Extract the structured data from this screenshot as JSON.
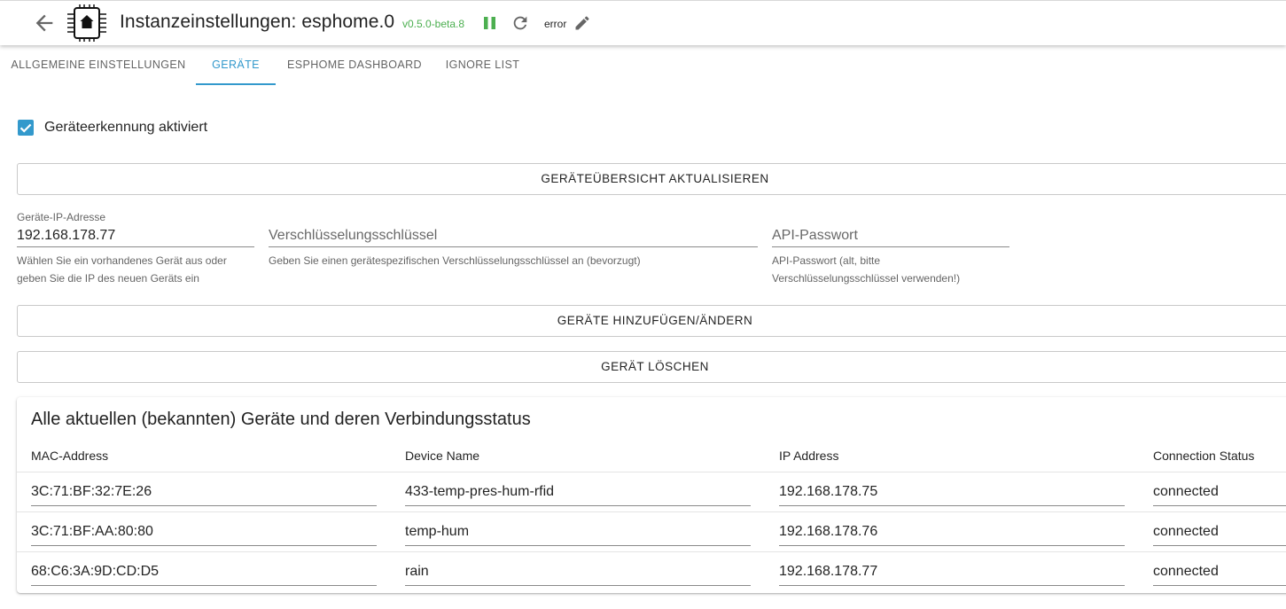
{
  "header": {
    "title": "Instanzeinstellungen:",
    "instance": "esphome.0",
    "version": "v0.5.0-beta.8",
    "status": "error",
    "icons": [
      "arrow-back-icon",
      "esphome-logo-icon",
      "pause-icon",
      "reload-icon",
      "pencil-icon"
    ],
    "version_color": "#4caf50"
  },
  "tabs": [
    {
      "label": "ALLGEMEINE EINSTELLUNGEN",
      "active": false
    },
    {
      "label": "GERÄTE",
      "active": true
    },
    {
      "label": "ESPHOME DASHBOARD",
      "active": false
    },
    {
      "label": "IGNORE LIST",
      "active": false
    }
  ],
  "accent_color": "#3399cc",
  "discovery": {
    "label": "Geräteerkennung aktiviert",
    "checked": true
  },
  "buttons": {
    "refresh": "GERÄTEÜBERSICHT AKTUALISIEREN",
    "add_change": "GERÄTE HINZUFÜGEN/ÄNDERN",
    "delete": "GERÄT LÖSCHEN"
  },
  "form": {
    "ip": {
      "label": "Geräte-IP-Adresse",
      "value": "192.168.178.77",
      "help_line1": "Wählen Sie ein vorhandenes Gerät aus oder",
      "help_line2": "geben Sie die IP des neuen Geräts ein"
    },
    "encryption_key": {
      "placeholder": "Verschlüsselungsschlüssel",
      "value": "",
      "help_line1": "Geben Sie einen gerätespezifischen Verschlüsselungsschlüssel an (bevorzugt)"
    },
    "api_password": {
      "placeholder": "API-Passwort",
      "value": "",
      "help_line1": "API-Passwort (alt, bitte",
      "help_line2": "Verschlüsselungsschlüssel verwenden!)"
    }
  },
  "devices_table": {
    "title": "Alle aktuellen (bekannten) Geräte und deren Verbindungsstatus",
    "headers": [
      "MAC-Address",
      "Device Name",
      "IP Address",
      "Connection Status"
    ],
    "rows": [
      [
        "3C:71:BF:32:7E:26",
        "433-temp-pres-hum-rfid",
        "192.168.178.75",
        "connected"
      ],
      [
        "3C:71:BF:AA:80:80",
        "temp-hum",
        "192.168.178.76",
        "connected"
      ],
      [
        "68:C6:3A:9D:CD:D5",
        "rain",
        "192.168.178.77",
        "connected"
      ]
    ]
  }
}
